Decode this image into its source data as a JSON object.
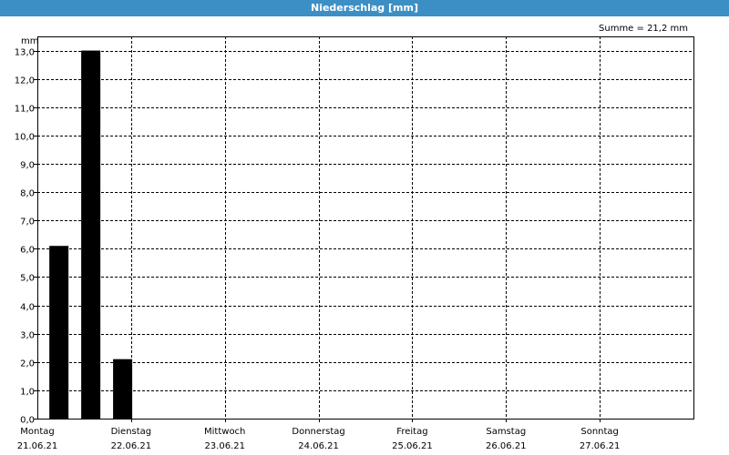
{
  "window": {
    "title": "Niederschlag [mm]"
  },
  "chart_data": {
    "type": "bar",
    "title": "Niederschlag [mm]",
    "ylabel": "mm",
    "annotation": "Summe = 21,2 mm",
    "ylim": [
      0,
      13.5
    ],
    "yticks": [
      0,
      1,
      2,
      3,
      4,
      5,
      6,
      7,
      8,
      9,
      10,
      11,
      12,
      13
    ],
    "ytick_labels": [
      "0,0",
      "1,0",
      "2,0",
      "3,0",
      "4,0",
      "5,0",
      "6,0",
      "7,0",
      "8,0",
      "9,0",
      "10,0",
      "11,0",
      "12,0",
      "13,0"
    ],
    "xrange_days": [
      0,
      7
    ],
    "day_labels": [
      {
        "day": "Montag",
        "date": "21.06.21"
      },
      {
        "day": "Dienstag",
        "date": "22.06.21"
      },
      {
        "day": "Mittwoch",
        "date": "23.06.21"
      },
      {
        "day": "Donnerstag",
        "date": "24.06.21"
      },
      {
        "day": "Freitag",
        "date": "25.06.21"
      },
      {
        "day": "Samstag",
        "date": "26.06.21"
      },
      {
        "day": "Sonntag",
        "date": "27.06.21"
      }
    ],
    "bars": [
      {
        "x": 0.23,
        "value": 6.1
      },
      {
        "x": 0.57,
        "value": 13.0
      },
      {
        "x": 0.91,
        "value": 2.1
      }
    ],
    "grid": true,
    "colors": {
      "bar": "#000000",
      "grid": "#000000",
      "titlebar": "#3c8fc4"
    }
  }
}
